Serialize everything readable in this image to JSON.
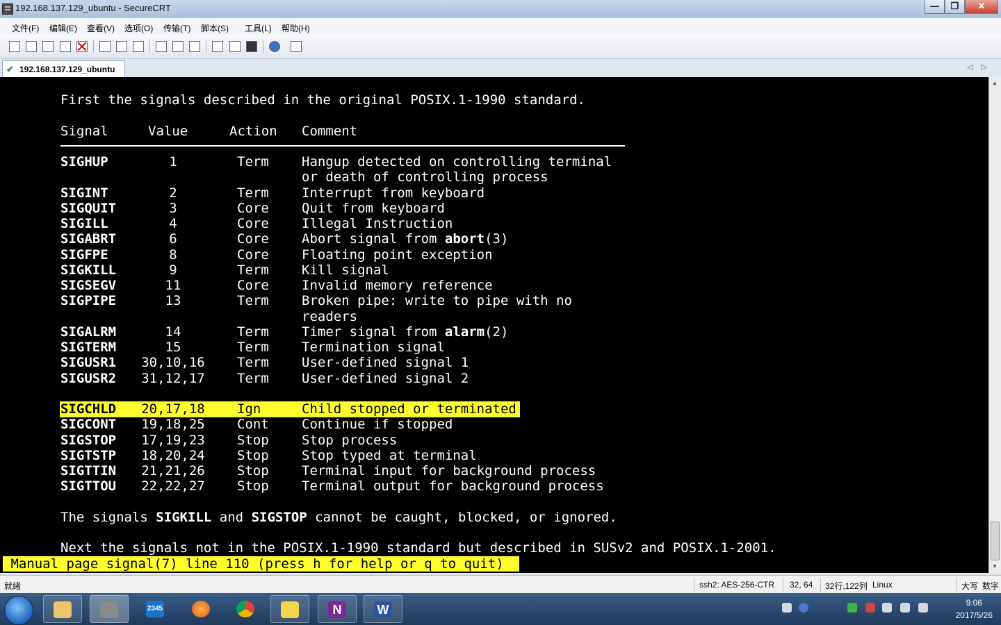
{
  "window": {
    "title": "192.168.137.129_ubuntu - SecureCRT",
    "buttons": {
      "minimize": "—",
      "maximize": "❐",
      "close": "✕"
    }
  },
  "menu": [
    "文件(F)",
    "编辑(E)",
    "查看(V)",
    "选项(O)",
    "传输(T)",
    "脚本(S)",
    "工具(L)",
    "帮助(H)"
  ],
  "tab": {
    "check": "✔",
    "label": "192.168.137.129_ubuntu"
  },
  "terminal": {
    "intro": "First the signals described in the original POSIX.1-1990 standard.",
    "headers": {
      "signal": "Signal",
      "value": "Value",
      "action": "Action",
      "comment": "Comment"
    },
    "rows": [
      {
        "signal": "SIGHUP",
        "value": "1",
        "action": "Term",
        "comment": "Hangup detected on controlling terminal"
      },
      {
        "signal": "",
        "value": "",
        "action": "",
        "comment": "or death of controlling process"
      },
      {
        "signal": "SIGINT",
        "value": "2",
        "action": "Term",
        "comment": "Interrupt from keyboard"
      },
      {
        "signal": "SIGQUIT",
        "value": "3",
        "action": "Core",
        "comment": "Quit from keyboard"
      },
      {
        "signal": "SIGILL",
        "value": "4",
        "action": "Core",
        "comment": "Illegal Instruction"
      },
      {
        "signal": "SIGABRT",
        "value": "6",
        "action": "Core",
        "comment": "Abort signal from ",
        "comment_bold": "abort",
        "comment_tail": "(3)"
      },
      {
        "signal": "SIGFPE",
        "value": "8",
        "action": "Core",
        "comment": "Floating point exception"
      },
      {
        "signal": "SIGKILL",
        "value": "9",
        "action": "Term",
        "comment": "Kill signal"
      },
      {
        "signal": "SIGSEGV",
        "value": "11",
        "action": "Core",
        "comment": "Invalid memory reference"
      },
      {
        "signal": "SIGPIPE",
        "value": "13",
        "action": "Term",
        "comment": "Broken pipe: write to pipe with no"
      },
      {
        "signal": "",
        "value": "",
        "action": "",
        "comment": "readers"
      },
      {
        "signal": "SIGALRM",
        "value": "14",
        "action": "Term",
        "comment": "Timer signal from ",
        "comment_bold": "alarm",
        "comment_tail": "(2)"
      },
      {
        "signal": "SIGTERM",
        "value": "15",
        "action": "Term",
        "comment": "Termination signal"
      },
      {
        "signal": "SIGUSR1",
        "value": "30,10,16",
        "action": "Term",
        "comment": "User-defined signal 1"
      },
      {
        "signal": "SIGUSR2",
        "value": "31,12,17",
        "action": "Term",
        "comment": "User-defined signal 2"
      },
      {
        "signal": "",
        "value": "",
        "action": "",
        "comment": ""
      },
      {
        "signal": "SIGCHLD",
        "value": "20,17,18",
        "action": "Ign",
        "comment": "Child stopped or terminated",
        "highlight": true
      },
      {
        "signal": "SIGCONT",
        "value": "19,18,25",
        "action": "Cont",
        "comment": "Continue if stopped"
      },
      {
        "signal": "SIGSTOP",
        "value": "17,19,23",
        "action": "Stop",
        "comment": "Stop process"
      },
      {
        "signal": "SIGTSTP",
        "value": "18,20,24",
        "action": "Stop",
        "comment": "Stop typed at terminal"
      },
      {
        "signal": "SIGTTIN",
        "value": "21,21,26",
        "action": "Stop",
        "comment": "Terminal input for background process"
      },
      {
        "signal": "SIGTTOU",
        "value": "22,22,27",
        "action": "Stop",
        "comment": "Terminal output for background process"
      }
    ],
    "note": {
      "p1": "The signals ",
      "b1": "SIGKILL",
      "p2": " and ",
      "b2": "SIGSTOP",
      "p3": " cannot be caught, blocked, or ignored."
    },
    "next": "Next the signals not in the POSIX.1-1990 standard but described in SUSv2 and POSIX.1-2001.",
    "manual_status": " Manual page signal(7) line 110 (press h for help or q to quit)"
  },
  "statusbar": {
    "ready": "就绪",
    "cipher": "ssh2: AES-256-CTR",
    "cursor": "32,  64",
    "size": "32行,122列",
    "os": "Linux",
    "caps": "大写",
    "num": "数字"
  },
  "taskbar": {
    "app_2345": "2345",
    "onenote": "N",
    "word": "W",
    "time": "9:06",
    "date": "2017/5/26"
  },
  "colors": {
    "highlight": "#ffff2e",
    "terminal_bg": "#000000",
    "terminal_fg": "#ffffff"
  }
}
